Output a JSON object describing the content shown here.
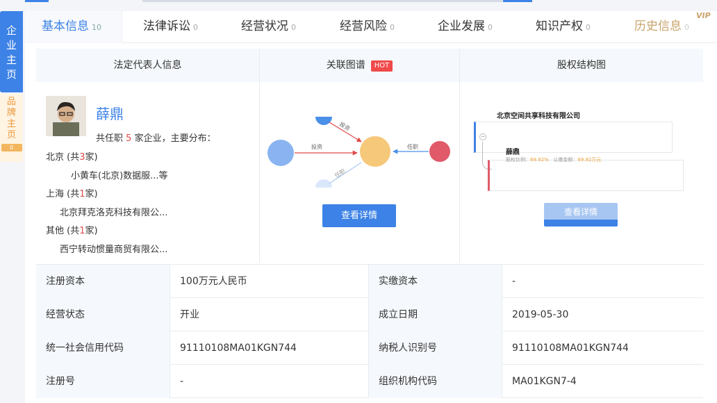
{
  "side_tabs": {
    "main": [
      "企",
      "业",
      "主",
      "页"
    ],
    "brand": [
      "品",
      "牌",
      "主",
      "页"
    ],
    "brand_count": "0"
  },
  "tabs": [
    {
      "label": "基本信息",
      "count": "10"
    },
    {
      "label": "法律诉讼",
      "count": "0"
    },
    {
      "label": "经营状况",
      "count": "0"
    },
    {
      "label": "经营风险",
      "count": "0"
    },
    {
      "label": "企业发展",
      "count": "0"
    },
    {
      "label": "知识产权",
      "count": "0"
    },
    {
      "label": "历史信息",
      "count": "0"
    }
  ],
  "vip_badge": "VIP",
  "legal_rep": {
    "header": "法定代表人信息",
    "name": "薛鼎",
    "summary_pre": "共任职",
    "summary_count": "5",
    "summary_post": "家企业，主要分布：",
    "groups": [
      {
        "region": "北京",
        "pre": "(共",
        "count": "3",
        "post": "家)",
        "company": "小黄车(北京)数据服...等"
      },
      {
        "region": "上海",
        "pre": "(共",
        "count": "1",
        "post": "家)",
        "company": "北京拜克洛克科技有限公..."
      },
      {
        "region": "其他",
        "pre": "(共",
        "count": "1",
        "post": "家)",
        "company": "西宁转动惯量商贸有限公..."
      }
    ]
  },
  "relation_map": {
    "header": "关联图谱",
    "hot": "HOT",
    "edge_labels": [
      "投资",
      "投资",
      "任职",
      "任职"
    ],
    "button": "查看详情"
  },
  "equity": {
    "header": "股权结构图",
    "company": "北京空间共享科技有限公司",
    "holder": "薛鼎",
    "ratio_label": "股权比例：",
    "ratio_value": "69.92%",
    "amount_label": "认缴金额：",
    "amount_value": "69.92万元",
    "button": "查看详情"
  },
  "info_rows": [
    {
      "l1": "注册资本",
      "v1": "100万元人民币",
      "l2": "实缴资本",
      "v2": "-"
    },
    {
      "l1": "经营状态",
      "v1": "开业",
      "l2": "成立日期",
      "v2": "2019-05-30"
    },
    {
      "l1": "统一社会信用代码",
      "v1": "91110108MA01KGN744",
      "l2": "纳税人识别号",
      "v2": "91110108MA01KGN744"
    },
    {
      "l1": "注册号",
      "v1": "-",
      "l2": "组织机构代码",
      "v2": "MA01KGN7-4"
    }
  ],
  "colors": {
    "accent": "#3d82e6",
    "hot": "#f04a4a",
    "vip": "#c9a46c",
    "node_red": "#e05a6a",
    "node_center": "#f6c87a"
  }
}
